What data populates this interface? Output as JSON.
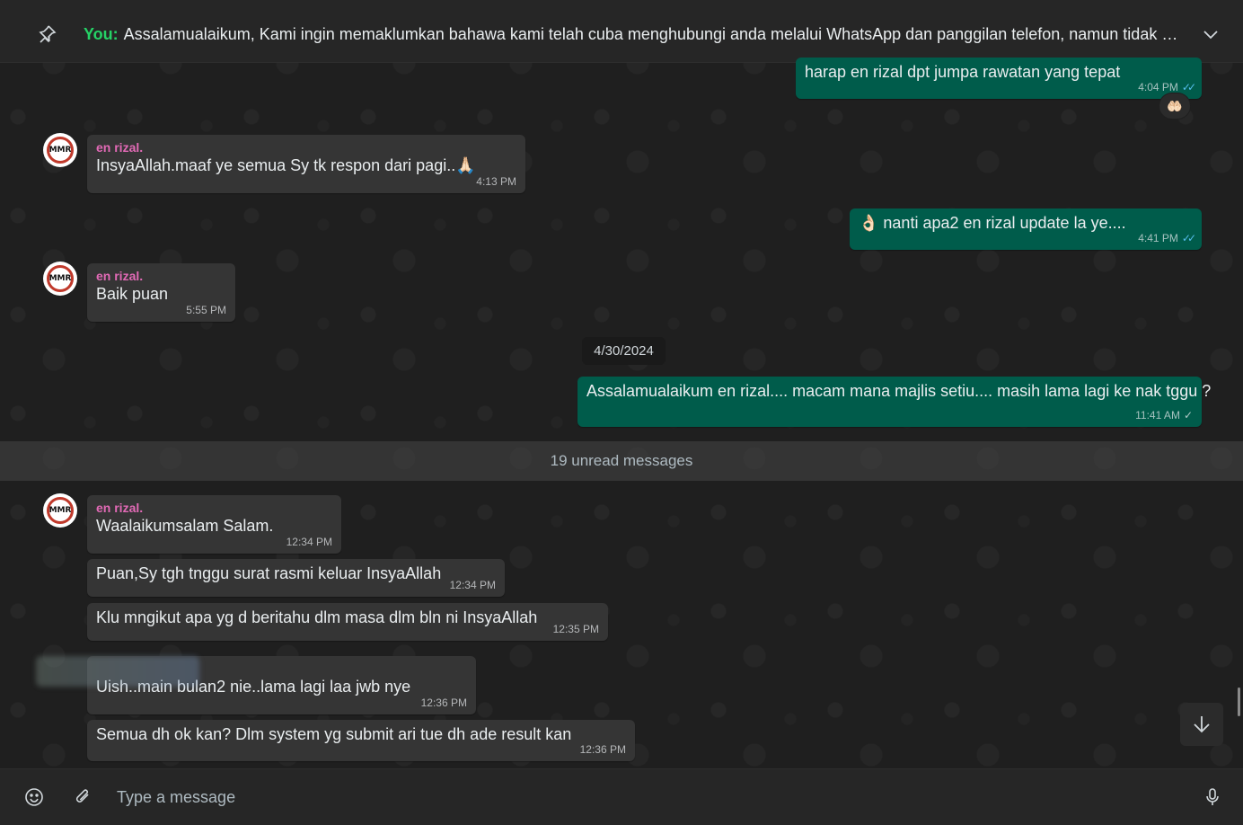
{
  "pinned": {
    "you_label": "You:",
    "text": "Assalamualaikum,  Kami ingin memaklumkan bahawa kami telah cuba menghubungi anda melalui WhatsApp dan panggilan telefon, namun tidak mener..."
  },
  "messages": {
    "m1": {
      "text": "harap en rizal dpt jumpa rawatan yang tepat",
      "time": "4:04 PM",
      "reaction": "🤲🏻"
    },
    "m2": {
      "sender": "en rizal.",
      "text": "InsyaAllah.maaf ye semua Sy tk respon dari pagi..🙏🏻",
      "time": "4:13 PM"
    },
    "m3": {
      "text": "👌🏻 nanti apa2 en rizal update la ye....",
      "time": "4:41 PM"
    },
    "m4": {
      "sender": "en rizal.",
      "text": "Baik puan",
      "time": "5:55 PM"
    },
    "date_chip": "4/30/2024",
    "m5": {
      "text": "Assalamualaikum en rizal.... macam mana majlis setiu....  masih lama lagi ke nak tggu ?",
      "time": "11:41 AM"
    },
    "unread": "19 unread messages",
    "m6": {
      "sender": "en rizal.",
      "text": "Waalaikumsalam Salam.",
      "time": "12:34 PM"
    },
    "m7": {
      "text": "Puan,Sy tgh tnggu surat rasmi keluar InsyaAllah",
      "time": "12:34 PM"
    },
    "m8": {
      "text": "Klu mngikut apa yg d beritahu dlm masa dlm bln ni InsyaAllah",
      "time": "12:35 PM"
    },
    "m9": {
      "text": "Uish..main bulan2 nie..lama lagi laa jwb nye",
      "time": "12:36 PM"
    },
    "m10": {
      "text": "Semua dh ok kan? Dlm system yg submit ari tue dh ade result kan",
      "time": "12:36 PM"
    }
  },
  "avatar_logo_text": "MMR",
  "composer": {
    "placeholder": "Type a message"
  },
  "colors": {
    "outgoing_bubble": "#005c4b",
    "incoming_bubble": "#353535",
    "sender_name": "#e26ab6",
    "you_label": "#25d366",
    "read_ticks": "#53bdeb"
  },
  "icons": {
    "pinned": "pin-icon",
    "expand": "chevron-down-icon",
    "emoji": "emoji-icon",
    "attach": "paperclip-icon",
    "mic": "microphone-icon",
    "scroll": "arrow-down-icon"
  }
}
